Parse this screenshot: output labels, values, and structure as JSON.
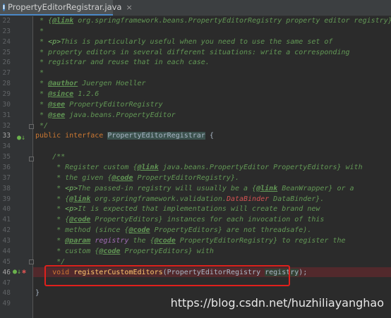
{
  "tab": {
    "filename": "PropertyEditorRegistrar.java",
    "close": "×"
  },
  "lines": [
    {
      "n": "22",
      "html": "<span class='c-doc'> * {</span><span class='c-tag'>@link</span><span class='c-doc'> org.springframework.beans.PropertyEditorRegistry property editor registry}.</span>"
    },
    {
      "n": "23",
      "html": "<span class='c-doc'> *</span>"
    },
    {
      "n": "24",
      "html": "<span class='c-doc'> * </span><span class='c-html'>&lt;p&gt;</span><span class='c-doc'>This is particularly useful when you need to use the same set of</span>"
    },
    {
      "n": "25",
      "html": "<span class='c-doc'> * property editors in several different situations: write a corresponding</span>"
    },
    {
      "n": "26",
      "html": "<span class='c-doc'> * registrar and reuse that in each case.</span>"
    },
    {
      "n": "27",
      "html": "<span class='c-doc'> *</span>"
    },
    {
      "n": "28",
      "html": "<span class='c-doc'> * </span><span class='c-tag'>@author</span><span class='c-doc'> Juergen Hoeller</span>"
    },
    {
      "n": "29",
      "html": "<span class='c-doc'> * </span><span class='c-tag'>@since</span><span class='c-doc'> 1.2.6</span>"
    },
    {
      "n": "30",
      "html": "<span class='c-doc'> * </span><span class='c-tag'>@see</span><span class='c-doc'> PropertyEditorRegistry</span>"
    },
    {
      "n": "31",
      "html": "<span class='c-doc'> * </span><span class='c-tag'>@see</span><span class='c-doc'> java.beans.PropertyEditor</span>"
    },
    {
      "n": "32",
      "html": "<span class='c-doc'> */</span>"
    },
    {
      "n": "33",
      "html": "<span class='c-kw'>public interface </span><span class='c-iface'>PropertyEditorRegistrar</span><span class='c-plain'> {</span>"
    },
    {
      "n": "34",
      "html": ""
    },
    {
      "n": "35",
      "html": "<span class='c-doc'>    /**</span>"
    },
    {
      "n": "36",
      "html": "<span class='c-doc'>     * Register custom {</span><span class='c-tag'>@link</span><span class='c-doc'> java.beans.PropertyEditor PropertyEditors} with</span>"
    },
    {
      "n": "37",
      "html": "<span class='c-doc'>     * the given {</span><span class='c-tag'>@code</span><span class='c-doc'> PropertyEditorRegistry}.</span>"
    },
    {
      "n": "38",
      "html": "<span class='c-doc'>     * </span><span class='c-html'>&lt;p&gt;</span><span class='c-doc'>The passed-in registry will usually be a {</span><span class='c-tag'>@link</span><span class='c-doc'> BeanWrapper} or a</span>"
    },
    {
      "n": "39",
      "html": "<span class='c-doc'>     * {</span><span class='c-tag'>@link</span><span class='c-doc'> org.springframework.validation.</span><span class='c-red'>DataBinder</span><span class='c-doc'> DataBinder}.</span>"
    },
    {
      "n": "40",
      "html": "<span class='c-doc'>     * </span><span class='c-html'>&lt;p&gt;</span><span class='c-doc'>It is expected that implementations will create brand new</span>"
    },
    {
      "n": "41",
      "html": "<span class='c-doc'>     * {</span><span class='c-tag'>@code</span><span class='c-doc'> PropertyEditors} instances for each invocation of this</span>"
    },
    {
      "n": "42",
      "html": "<span class='c-doc'>     * method (since {</span><span class='c-tag'>@code</span><span class='c-doc'> PropertyEditors} are not threadsafe).</span>"
    },
    {
      "n": "43",
      "html": "<span class='c-doc'>     * </span><span class='c-tag'>@param</span><span class='c-doc'> </span><span class='c-ref'>registry</span><span class='c-doc'> the {</span><span class='c-tag'>@code</span><span class='c-doc'> PropertyEditorRegistry} to register the</span>"
    },
    {
      "n": "44",
      "html": "<span class='c-doc'>     * custom {</span><span class='c-tag'>@code</span><span class='c-doc'> PropertyEditors} with</span>"
    },
    {
      "n": "45",
      "html": "<span class='c-doc'>     */</span>"
    },
    {
      "n": "46",
      "html": "<span class='c-kw'>    void </span><span class='c-method'>registerCustomEditors</span><span class='c-plain'>(PropertyEditorRegistry </span><span class='c-param'>registry</span><span class='c-plain'>);</span>"
    },
    {
      "n": "47",
      "html": ""
    },
    {
      "n": "48",
      "html": "<span class='c-plain'>}</span>"
    },
    {
      "n": "49",
      "html": ""
    }
  ],
  "watermark": "https://blog.csdn.net/huzhiliayanghao",
  "colors": {
    "keyword": "#cc7832",
    "doc_comment": "#629755",
    "method": "#ffc66d",
    "red_box": "#e0201c"
  }
}
